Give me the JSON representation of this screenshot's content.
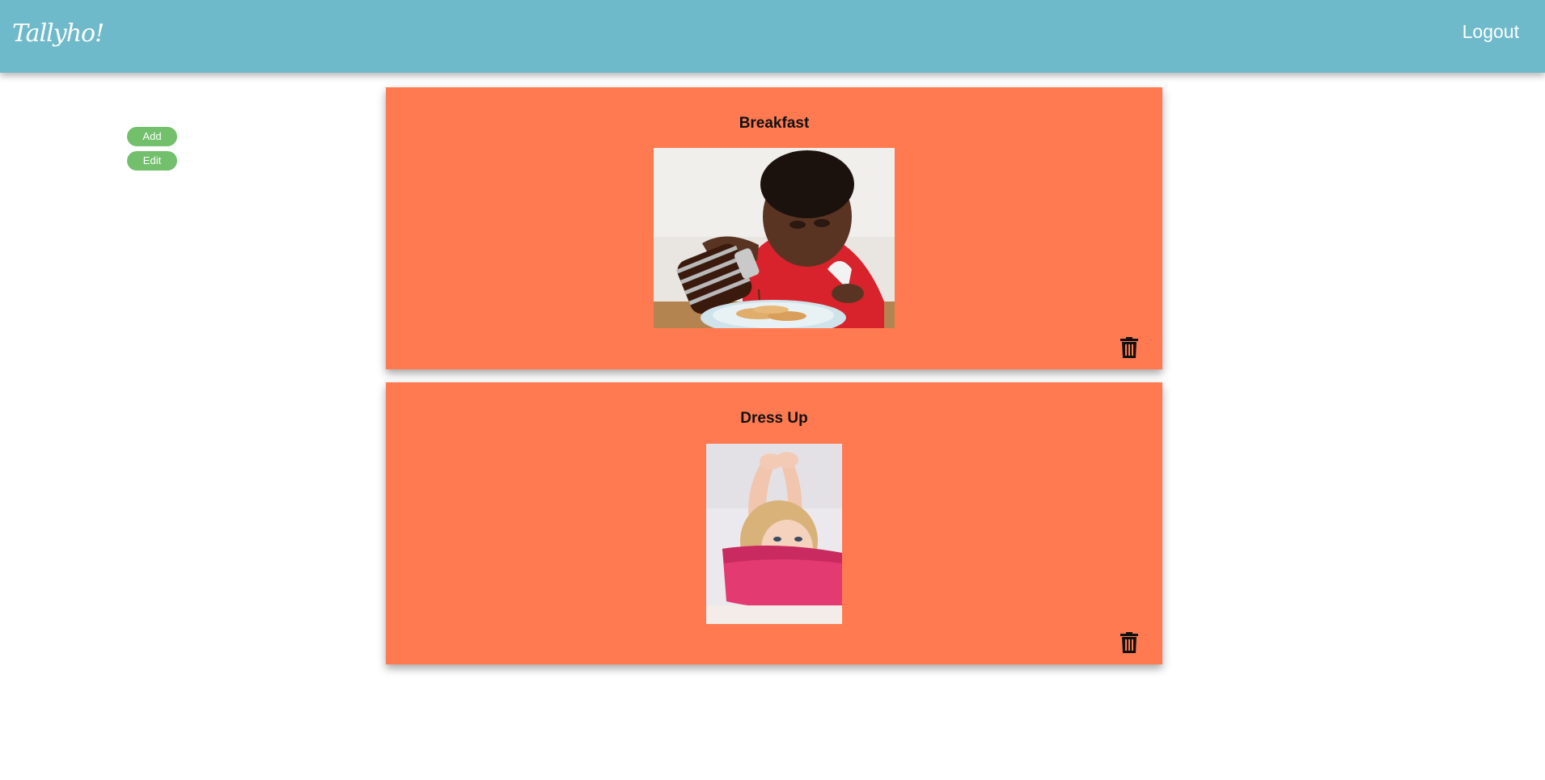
{
  "header": {
    "logo_text": "Tallyho!",
    "logout_label": "Logout",
    "background_color": "#6fbaca"
  },
  "sidebar": {
    "add_label": "Add",
    "edit_label": "Edit",
    "button_color": "#72bf6c"
  },
  "cards": [
    {
      "title": "Breakfast",
      "image_icon": "photo-child-pouring-syrup-on-pancakes",
      "delete_icon": "trash-icon"
    },
    {
      "title": "Dress Up",
      "image_icon": "photo-child-pulling-on-pink-shirt",
      "delete_icon": "trash-icon"
    }
  ],
  "card_color": "#ff7a50"
}
